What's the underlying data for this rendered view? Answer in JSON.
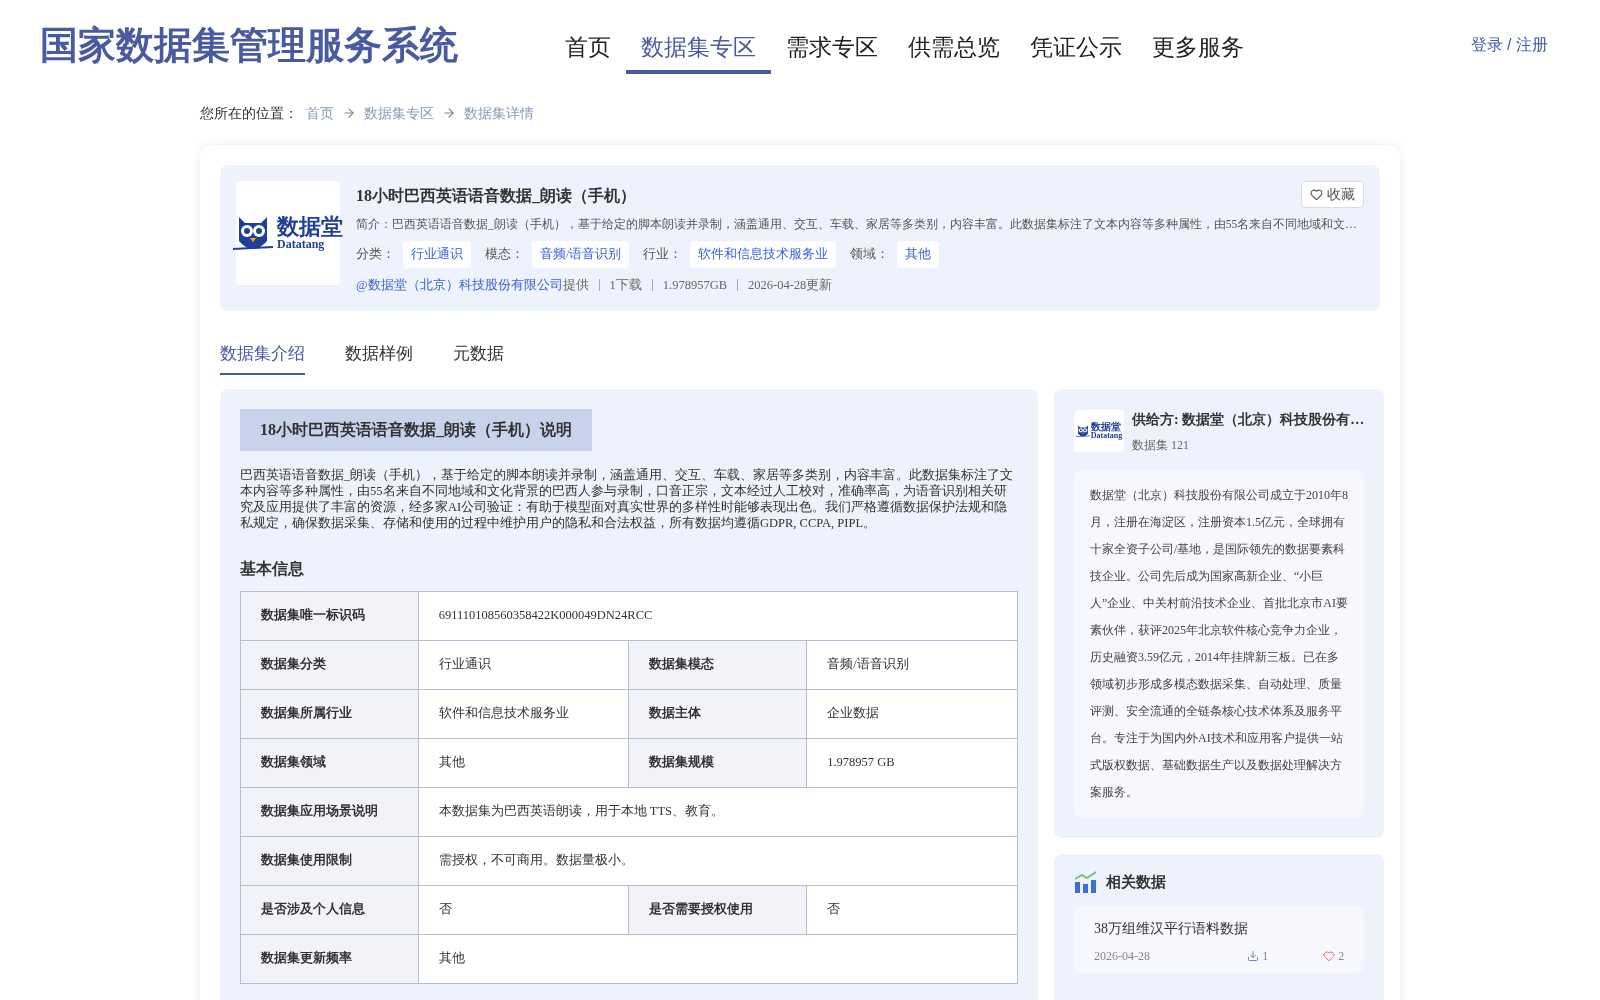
{
  "site_title": "国家数据集管理服务系统",
  "nav": [
    {
      "label": "首页",
      "selected": false
    },
    {
      "label": "数据集专区",
      "selected": true
    },
    {
      "label": "需求专区",
      "selected": false
    },
    {
      "label": "供需总览",
      "selected": false
    },
    {
      "label": "凭证公示",
      "selected": false
    },
    {
      "label": "更多服务",
      "selected": false
    }
  ],
  "login": "登录 / 注册",
  "breadcrumb": {
    "label": "您所在的位置：",
    "items": [
      "首页",
      "数据集专区",
      "数据集详情"
    ]
  },
  "dataset": {
    "logo_text": "数据堂",
    "logo_subtext": "Datatang",
    "title": "18小时巴西英语语音数据_朗读（手机）",
    "favorite": "收藏",
    "summary": "简介：巴西英语语音数据_朗读（手机），基于给定的脚本朗读并录制，涵盖通用、交互、车载、家居等多类别，内容丰富。此数据集标注了文本内容等多种属性，由55名来自不同地域和文…",
    "tags": [
      {
        "label": "分类：",
        "value": "行业通识"
      },
      {
        "label": "模态：",
        "value": "音频/语音识别"
      },
      {
        "label": "行业：",
        "value": "软件和信息技术服务业"
      },
      {
        "label": "领域：",
        "value": "其他"
      }
    ],
    "provider": "@数据堂（北京）科技股份有限公司",
    "provider_suffix": "提供",
    "meta": [
      "1下载",
      "1.978957GB",
      "2026-04-28更新"
    ]
  },
  "tabs": [
    {
      "label": "数据集介绍",
      "selected": true
    },
    {
      "label": "数据样例",
      "selected": false
    },
    {
      "label": "元数据",
      "selected": false
    }
  ],
  "intro": {
    "heading": "18小时巴西英语语音数据_朗读（手机）说明",
    "text": "巴西英语语音数据_朗读（手机），基于给定的脚本朗读并录制，涵盖通用、交互、车载、家居等多类别，内容丰富。此数据集标注了文本内容等多种属性，由55名来自不同地域和文化背景的巴西人参与录制，口音正宗，文本经过人工校对，准确率高，为语音识别相关研究及应用提供了丰富的资源，经多家AI公司验证：有助于模型面对真实世界的多样性时能够表现出色。我们严格遵循数据保护法规和隐私规定，确保数据采集、存储和使用的过程中维护用户的隐私和合法权益，所有数据均遵循GDPR, CCPA, PIPL。"
  },
  "basic_info": {
    "heading": "基本信息",
    "rows": [
      [
        {
          "label": "数据集唯一标识码",
          "value": "691110108560358422K000049DN24RCC"
        }
      ],
      [
        {
          "label": "数据集分类",
          "value": "行业通识"
        },
        {
          "label": "数据集模态",
          "value": "音频/语音识别"
        }
      ],
      [
        {
          "label": "数据集所属行业",
          "value": "软件和信息技术服务业"
        },
        {
          "label": "数据主体",
          "value": "企业数据"
        }
      ],
      [
        {
          "label": "数据集领域",
          "value": "其他"
        },
        {
          "label": "数据集规模",
          "value": "1.978957 GB"
        }
      ],
      [
        {
          "label": "数据集应用场景说明",
          "value": "本数据集为巴西英语朗读，用于本地 TTS、教育。"
        }
      ],
      [
        {
          "label": "数据集使用限制",
          "value": "需授权，不可商用。数据量极小。"
        }
      ],
      [
        {
          "label": "是否涉及个人信息",
          "value": "否"
        },
        {
          "label": "是否需要授权使用",
          "value": "否"
        }
      ],
      [
        {
          "label": "数据集更新频率",
          "value": "其他"
        }
      ]
    ]
  },
  "supplier": {
    "logo_text": "数据堂",
    "logo_subtext": "Datatang",
    "name": "供给方: 数据堂（北京）科技股份有…",
    "count": "数据集 121",
    "description": "数据堂（北京）科技股份有限公司成立于2010年8月，注册在海淀区，注册资本1.5亿元，全球拥有十家全资子公司/基地，是国际领先的数据要素科技企业。公司先后成为国家高新企业、“小巨人”企业、中关村前沿技术企业、首批北京市AI要素伙伴，获评2025年北京软件核心竞争力企业，历史融资3.59亿元，2014年挂牌新三板。已在多领域初步形成多模态数据采集、自动处理、质量评测、安全流通的全链条核心技术体系及服务平台。专注于为国内外AI技术和应用客户提供一站式版权数据、基础数据生产以及数据处理解决方案服务。"
  },
  "related": {
    "heading": "相关数据",
    "items": [
      {
        "title": "38万组维汉平行语料数据",
        "date": "2026-04-28",
        "downloads": "1",
        "likes": "2"
      }
    ]
  }
}
